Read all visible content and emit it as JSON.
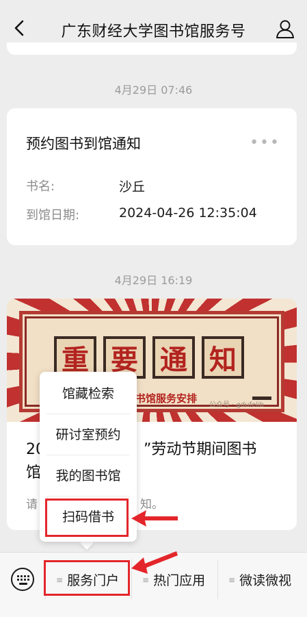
{
  "header": {
    "title": "广东财经大学图书馆服务号"
  },
  "messages": [
    {
      "timestamp": "4月29日 07:46",
      "notice_title": "预约图书到馆通知",
      "fields": [
        {
          "label": "书名:",
          "value": "沙丘"
        },
        {
          "label": "到馆日期:",
          "value": "2024-04-26 12:35:04"
        }
      ]
    },
    {
      "timestamp": "4月29日 16:19",
      "banner": {
        "chars": [
          "重",
          "要",
          "通",
          "知"
        ],
        "subtitle": "图书馆服务安排",
        "watermark": "公众号 · gdufelib"
      },
      "title_line1_left": "20",
      "title_line1_right": "”劳动节期间图书",
      "title_line2_left": "馆",
      "desc_left": "请",
      "desc_right": "知。"
    }
  ],
  "popup_menu": {
    "items": [
      "馆藏检索",
      "研讨室预约",
      "我的图书馆",
      "扫码借书"
    ]
  },
  "bottom_menu": {
    "items": [
      "服务门户",
      "热门应用",
      "微读微视"
    ]
  },
  "colors": {
    "accent_red": "#e3262b",
    "background": "#ededed"
  }
}
